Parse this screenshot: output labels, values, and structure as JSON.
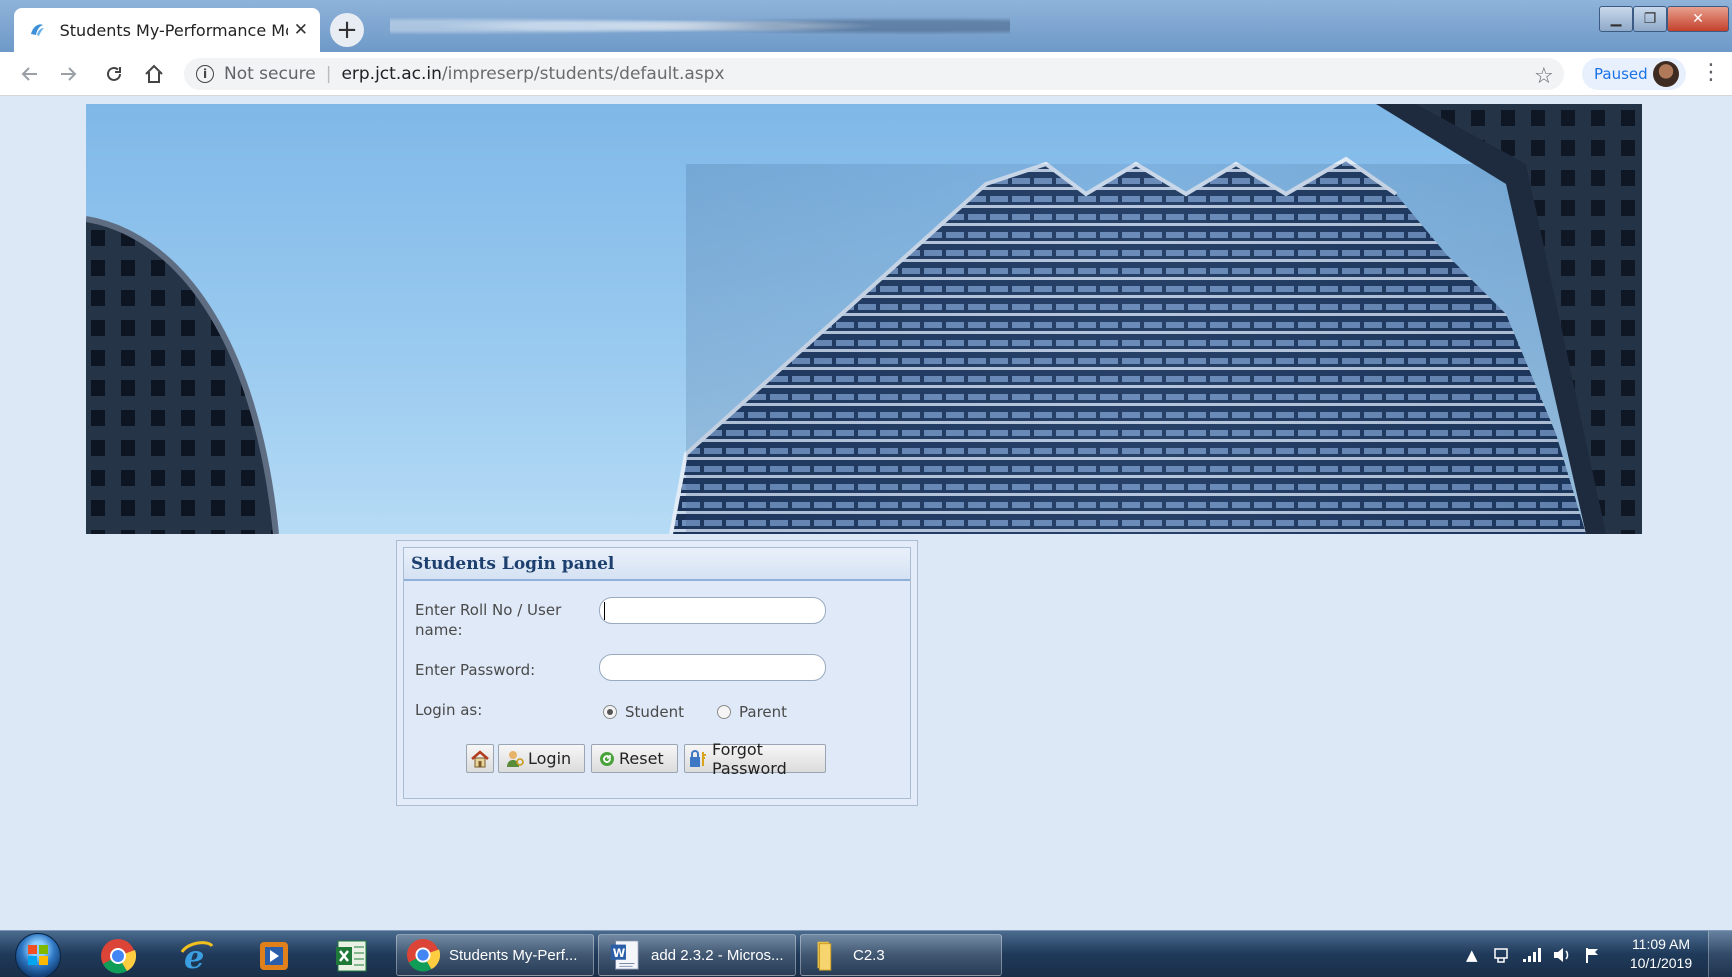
{
  "browser": {
    "tab_title": "Students My-Performance Modu",
    "tab_close": "✕",
    "new_tab": "+",
    "not_secure": "Not secure",
    "url_host": "erp.jct.ac.in",
    "url_path": "/impreserp/students/default.aspx",
    "profile_status": "Paused",
    "window_controls": {
      "minimize": "▁",
      "maximize": "❐",
      "close": "✕"
    }
  },
  "login_panel": {
    "title": "Students Login panel",
    "username_label": "Enter Roll No / User name:",
    "username_value": "",
    "password_label": "Enter Password:",
    "password_value": "",
    "login_as_label": "Login as:",
    "role_options": [
      "Student",
      "Parent"
    ],
    "selected_role": "Student",
    "buttons": {
      "login": "Login",
      "reset": "Reset",
      "forgot": "Forgot Password"
    }
  },
  "taskbar": {
    "tasks": [
      {
        "label": "Students My-Perf...",
        "icon": "chrome-icon"
      },
      {
        "label": "add 2.3.2 - Micros...",
        "icon": "word-icon"
      },
      {
        "label": "C2.3",
        "icon": "folder-icon"
      }
    ],
    "clock_time": "11:09 AM",
    "clock_date": "10/1/2019"
  }
}
